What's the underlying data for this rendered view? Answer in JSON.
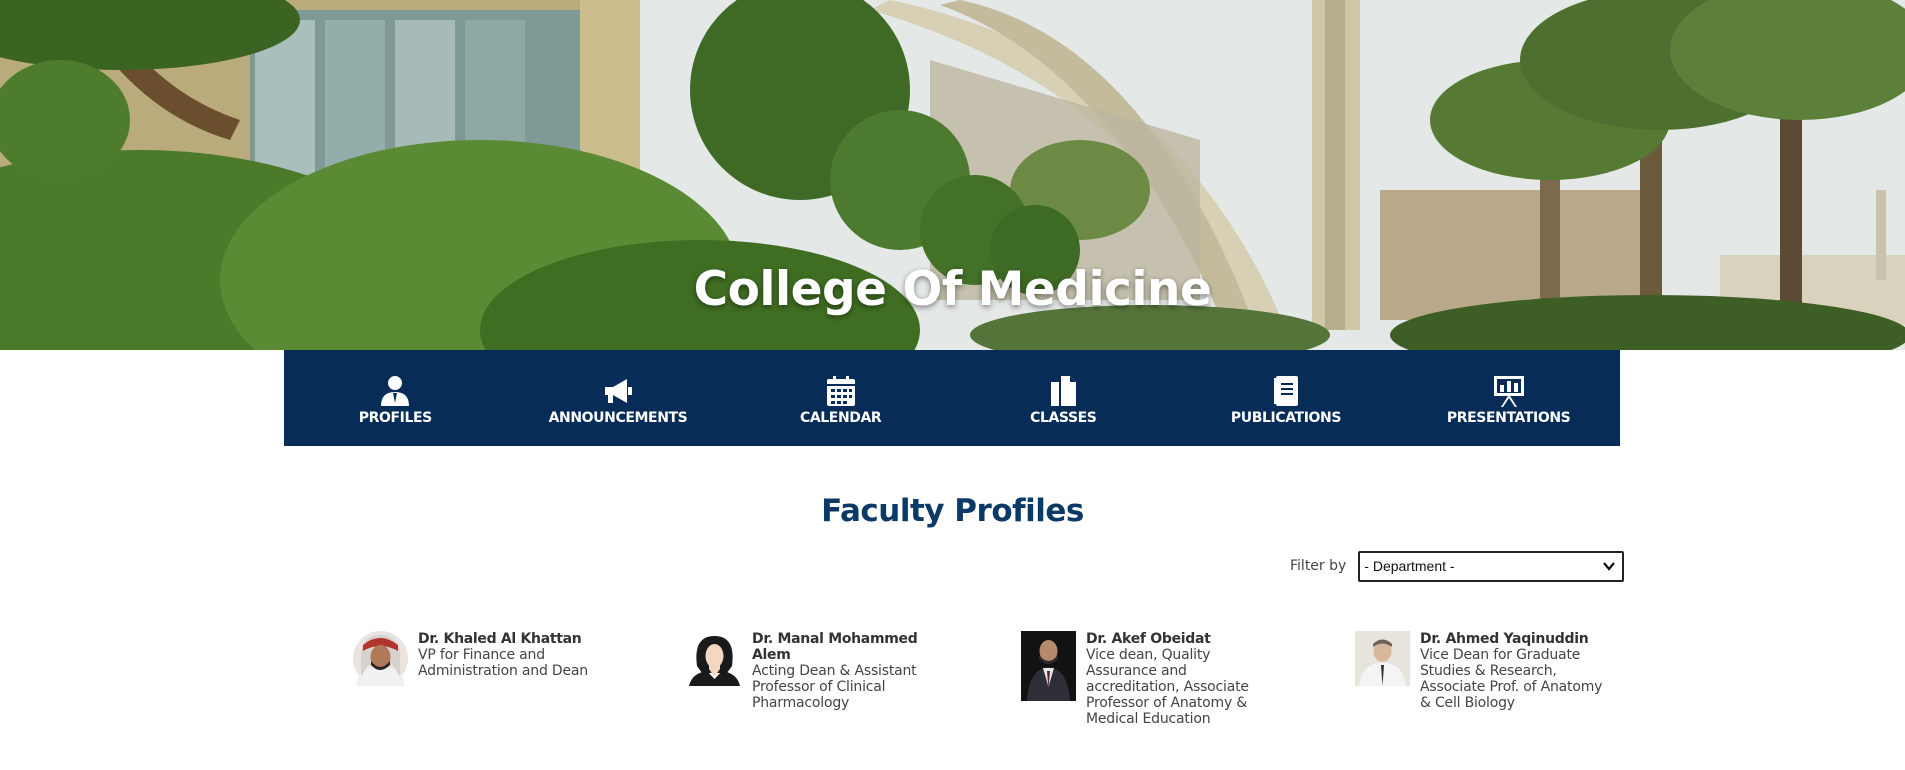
{
  "hero": {
    "title": "College Of Medicine"
  },
  "nav": {
    "items": [
      {
        "label": "PROFILES",
        "icon": "person-icon"
      },
      {
        "label": "ANNOUNCEMENTS",
        "icon": "megaphone-icon"
      },
      {
        "label": "CALENDAR",
        "icon": "calendar-icon"
      },
      {
        "label": "CLASSES",
        "icon": "documents-icon"
      },
      {
        "label": "PUBLICATIONS",
        "icon": "book-icon"
      },
      {
        "label": "PRESENTATIONS",
        "icon": "presentation-board-icon"
      }
    ]
  },
  "main": {
    "title": "Faculty Profiles",
    "filter": {
      "label": "Filter by",
      "selected": "- Department -"
    },
    "profiles": [
      {
        "name": "Dr. Khaled Al Khattan",
        "title": "VP for Finance and Administration and Dean"
      },
      {
        "name": "Dr. Manal Mohammed Alem",
        "title": "Acting Dean & Assistant Professor of Clinical Pharmacology"
      },
      {
        "name": "Dr. Akef Obeidat",
        "title": "Vice dean, Quality Assurance and accreditation, Associate Professor of Anatomy & Medical Education"
      },
      {
        "name": "Dr. Ahmed Yaqinuddin",
        "title": "Vice Dean for Graduate Studies & Research, Associate Prof. of Anatomy & Cell Biology"
      }
    ]
  },
  "colors": {
    "navbar": "#062c57",
    "heading": "#0c3a67"
  }
}
